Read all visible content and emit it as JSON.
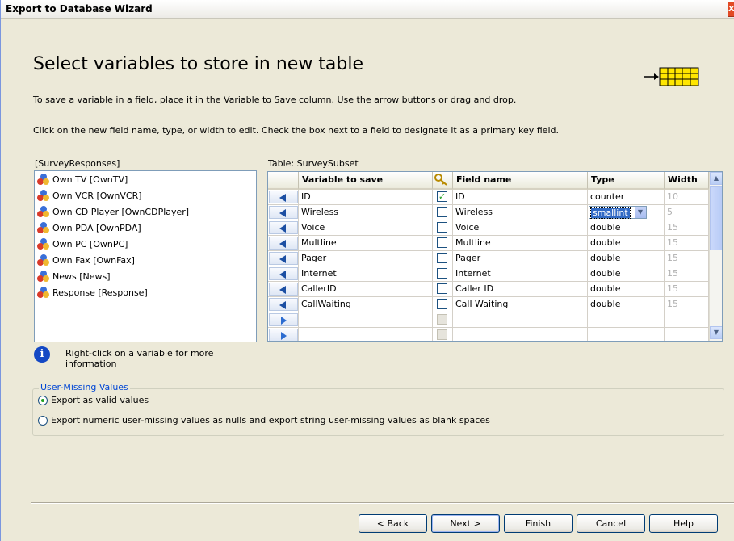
{
  "window": {
    "title": "Export to Database Wizard"
  },
  "page": {
    "heading": "Select variables to store in new table",
    "instruction1": "To save a variable in a field, place it in the Variable to Save column. Use the arrow buttons or drag and drop.",
    "instruction2": "Click on the new field name, type, or width to edit. Check the box next to a field to designate it as a primary key field."
  },
  "source": {
    "label": "[SurveyResponses]",
    "items": [
      "Own TV [OwnTV]",
      "Own VCR [OwnVCR]",
      "Own CD Player [OwnCDPlayer]",
      "Own PDA [OwnPDA]",
      "Own PC [OwnPC]",
      "Own Fax [OwnFax]",
      "News [News]",
      "Response [Response]"
    ]
  },
  "info": {
    "text": "Right-click on a variable for more information"
  },
  "table": {
    "label": "Table: SurveySubset",
    "headers": {
      "variable": "Variable to save",
      "key": "",
      "field": "Field name",
      "type": "Type",
      "width": "Width"
    },
    "rows": [
      {
        "variable": "ID",
        "key": true,
        "field": "ID",
        "type": "counter",
        "width": "10"
      },
      {
        "variable": "Wireless",
        "key": false,
        "field": "Wireless",
        "type": "smallint",
        "width": "5"
      },
      {
        "variable": "Voice",
        "key": false,
        "field": "Voice",
        "type": "double",
        "width": "15"
      },
      {
        "variable": "Multline",
        "key": false,
        "field": "Multline",
        "type": "double",
        "width": "15"
      },
      {
        "variable": "Pager",
        "key": false,
        "field": "Pager",
        "type": "double",
        "width": "15"
      },
      {
        "variable": "Internet",
        "key": false,
        "field": "Internet",
        "type": "double",
        "width": "15"
      },
      {
        "variable": "CallerID",
        "key": false,
        "field": "Caller ID",
        "type": "double",
        "width": "15"
      },
      {
        "variable": "CallWaiting",
        "key": false,
        "field": "Call Waiting",
        "type": "double",
        "width": "15"
      },
      {
        "variable": "",
        "key": false,
        "field": "",
        "type": "",
        "width": ""
      },
      {
        "variable": "",
        "key": false,
        "field": "",
        "type": "",
        "width": ""
      }
    ]
  },
  "missing": {
    "legend": "User-Missing Values",
    "option1": "Export as valid values",
    "option2": "Export numeric user-missing values as nulls and export string user-missing values as blank spaces",
    "selected": 1
  },
  "buttons": {
    "back": "< Back",
    "next": "Next >",
    "finish": "Finish",
    "cancel": "Cancel",
    "help": "Help"
  }
}
